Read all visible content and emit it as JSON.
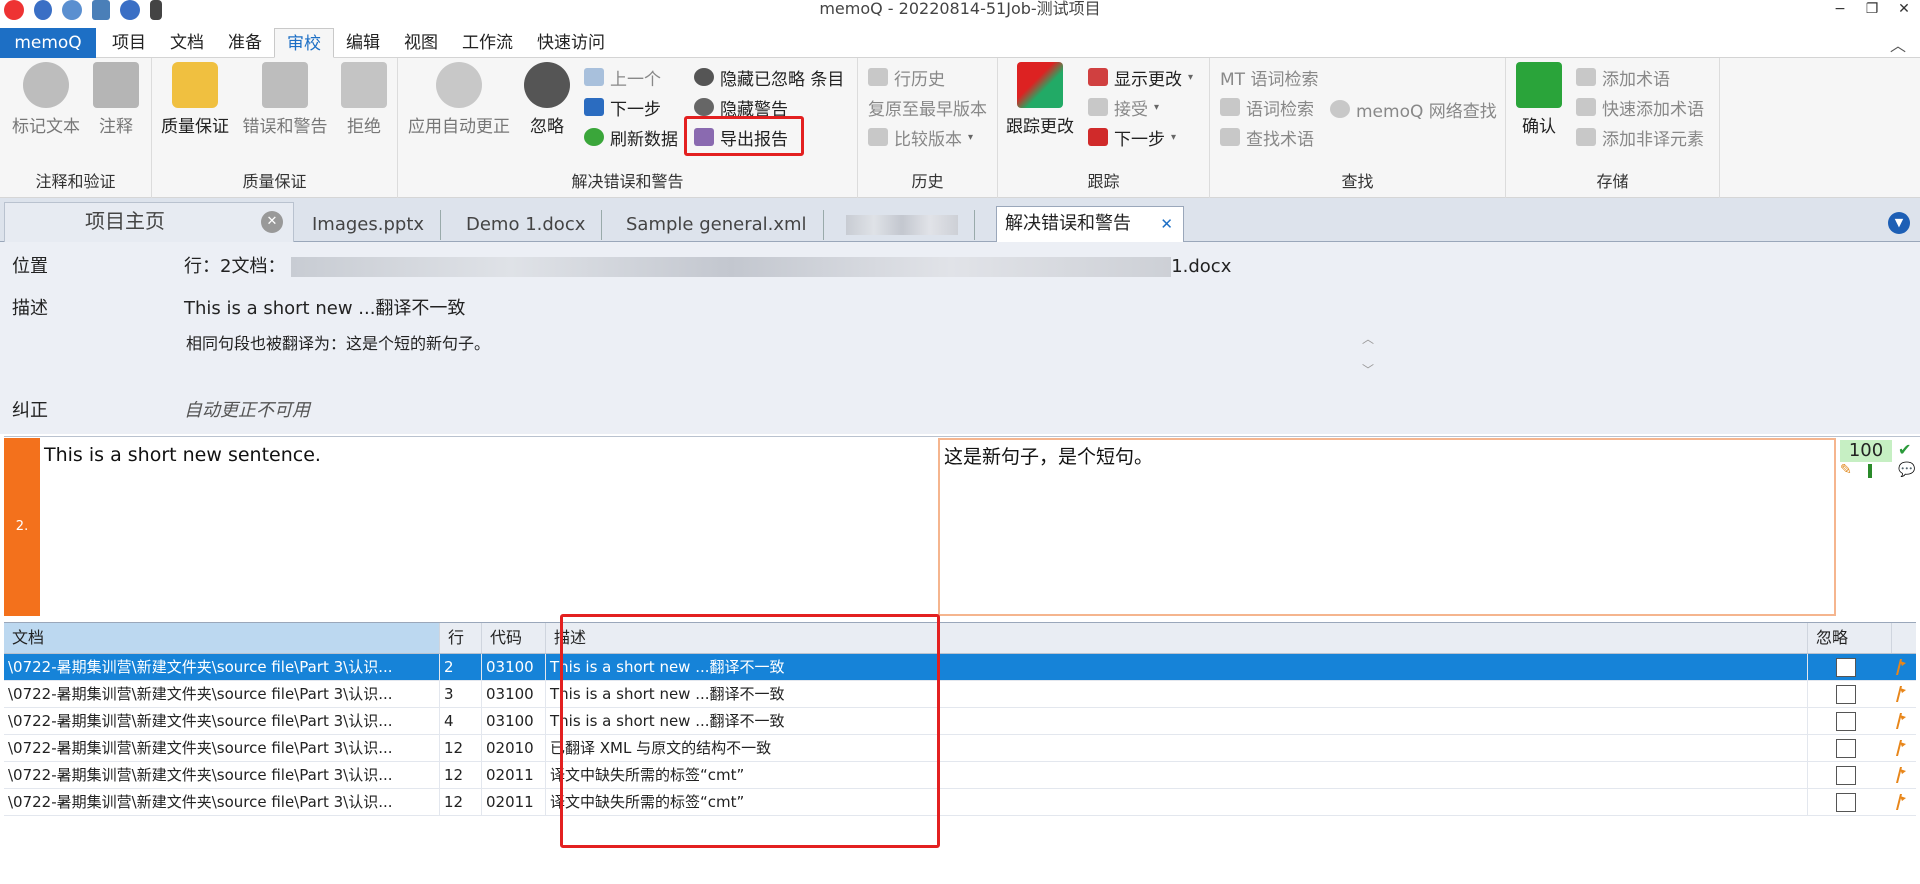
{
  "title": "memoQ - 20220814-51Job-测试项目",
  "window_controls": [
    "−",
    "❐",
    "✕"
  ],
  "menu": {
    "app": "memoQ",
    "items": [
      "项目",
      "文档",
      "准备",
      "审校",
      "编辑",
      "视图",
      "工作流",
      "快速访问"
    ],
    "active": "审校"
  },
  "ribbon": {
    "group_annotate": {
      "label": "注释和验证",
      "mark_text": "标记文本",
      "comment": "注释"
    },
    "group_qa": {
      "label": "质量保证",
      "qa": "质量保证",
      "errors_warnings": "错误和警告",
      "reject": "拒绝"
    },
    "group_resolve": {
      "label": "解决错误和警告",
      "apply_autocorrect": "应用自动更正",
      "ignore": "忽略",
      "prev": "上一个",
      "next": "下一步",
      "refresh": "刷新数据",
      "hide_ignored": "隐藏已忽略 条目",
      "hide_warnings": "隐藏警告",
      "export_report": "导出报告"
    },
    "group_history": {
      "label": "历史",
      "row_history": "行历史",
      "restore": "复原至最早版本",
      "compare": "比较版本"
    },
    "group_track": {
      "label": "跟踪",
      "track_changes": "跟踪更改",
      "show_changes": "显示更改",
      "accept": "接受",
      "next": "下一步"
    },
    "group_search": {
      "label": "查找",
      "mt_concordance": "MT 语词检索",
      "concordance": "语词检索",
      "find_term": "查找术语",
      "web_search": "memoQ 网络查找"
    },
    "group_store": {
      "label": "存储",
      "confirm": "确认",
      "add_term": "添加术语",
      "quick_add_term": "快速添加术语",
      "add_nontrans": "添加非译元素"
    }
  },
  "tabs": {
    "home": "项目主页",
    "docs": [
      "Images.pptx",
      "Demo 1.docx",
      "Sample general.xml"
    ],
    "active": "解决错误和警告"
  },
  "info": {
    "location_label": "位置",
    "location_value_prefix": "行：2文档：",
    "location_value_suffix": "1.docx",
    "desc_label": "描述",
    "desc_value": "This is a short new ...翻译不一致",
    "desc_sub": "相同句段也被翻译为：这是个短的新句子。",
    "fix_label": "纠正",
    "fix_value": "自动更正不可用"
  },
  "segment": {
    "number": "2.",
    "source": "This is a short new sentence.",
    "target": "这是新句子，是个短句。",
    "match": "100"
  },
  "grid": {
    "headers": {
      "doc": "文档",
      "row": "行",
      "code": "代码",
      "desc": "描述",
      "ignore": "忽略"
    },
    "rows": [
      {
        "doc": "\\0722-暑期集训营\\新建文件夹\\source file\\Part 3\\认识...",
        "row": "2",
        "code": "03100",
        "desc": "This is a short new ...翻译不一致",
        "selected": true
      },
      {
        "doc": "\\0722-暑期集训营\\新建文件夹\\source file\\Part 3\\认识...",
        "row": "3",
        "code": "03100",
        "desc": "This is a short new ...翻译不一致",
        "selected": false
      },
      {
        "doc": "\\0722-暑期集训营\\新建文件夹\\source file\\Part 3\\认识...",
        "row": "4",
        "code": "03100",
        "desc": "This is a short new ...翻译不一致",
        "selected": false
      },
      {
        "doc": "\\0722-暑期集训营\\新建文件夹\\source file\\Part 3\\认识...",
        "row": "12",
        "code": "02010",
        "desc": "已翻译 XML 与原文的结构不一致",
        "selected": false
      },
      {
        "doc": "\\0722-暑期集训营\\新建文件夹\\source file\\Part 3\\认识...",
        "row": "12",
        "code": "02011",
        "desc": "译文中缺失所需的标签“cmt”",
        "selected": false
      },
      {
        "doc": "\\0722-暑期集训营\\新建文件夹\\source file\\Part 3\\认识...",
        "row": "12",
        "code": "02011",
        "desc": "译文中缺失所需的标签“cmt”",
        "selected": false
      }
    ]
  },
  "colors": {
    "accent": "#1d6fc5",
    "selection": "#1683d8",
    "segment_marker": "#f3711c",
    "highlight": "#e32020"
  }
}
